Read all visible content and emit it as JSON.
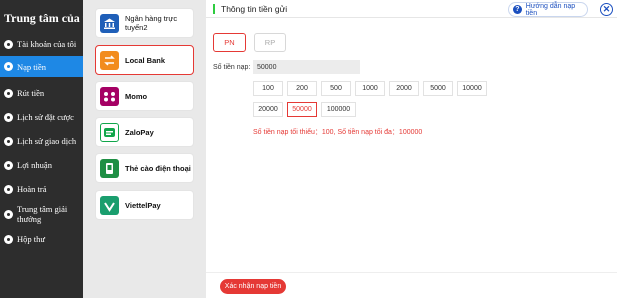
{
  "sidebar": {
    "title": "Trung tâm của tôi",
    "items": [
      {
        "label": "Tài khoản của tôi",
        "icon": "user-icon",
        "active": false
      },
      {
        "label": "Nạp tiền",
        "icon": "deposit-icon",
        "active": true
      },
      {
        "label": "Rút tiền",
        "icon": "withdraw-icon",
        "active": false
      },
      {
        "label": "Lịch sử đặt cược",
        "icon": "history-icon",
        "active": false
      },
      {
        "label": "Lịch sử giao dịch",
        "icon": "transaction-icon",
        "active": false
      },
      {
        "label": "Lợi nhuận",
        "icon": "profit-icon",
        "active": false
      },
      {
        "label": "Hoàn trả",
        "icon": "refund-icon",
        "active": false
      },
      {
        "label": "Trung tâm giải thưởng",
        "icon": "reward-icon",
        "active": false
      },
      {
        "label": "Hộp thư",
        "icon": "mail-icon",
        "active": false
      }
    ]
  },
  "methods": [
    {
      "label": "Ngân hàng trực tuyến2",
      "logo": "bank-icon",
      "color": "#1f5fb8",
      "selected": false
    },
    {
      "label": "Local Bank",
      "logo": "local-bank-icon",
      "color": "#f28c1d",
      "selected": true
    },
    {
      "label": "Momo",
      "logo": "momo-icon",
      "color": "#a50064",
      "selected": false
    },
    {
      "label": "ZaloPay",
      "logo": "zalopay-icon",
      "color": "#10a64a",
      "selected": false
    },
    {
      "label": "Thẻ cào điện thoại",
      "logo": "phone-card-icon",
      "color": "#1f8f44",
      "selected": false
    },
    {
      "label": "ViettelPay",
      "logo": "viettelpay-icon",
      "color": "#1a9e6e",
      "selected": false
    }
  ],
  "header": {
    "title": "Thông tin tiền gửi",
    "guide_label": "Hướng dẫn nạp tiền",
    "guide_icon": "?",
    "close_glyph": "✕"
  },
  "tabs": {
    "pn": "PN",
    "rp": "RP"
  },
  "amount": {
    "label": "Số tiền nạp:",
    "value": "50000",
    "chips": [
      "100",
      "200",
      "500",
      "1000",
      "2000",
      "5000",
      "10000",
      "20000",
      "50000",
      "100000"
    ],
    "selected_chip": "50000",
    "limit_text": "Số tiền nạp tối thiểu：100,  Số tiền nạp tối đa：100000"
  },
  "confirm_label": "Xác nhận nạp tiền",
  "colors": {
    "accent": "#e53935",
    "active_menu": "#1e88e5",
    "sidebar_bg": "#2d2d2d"
  }
}
